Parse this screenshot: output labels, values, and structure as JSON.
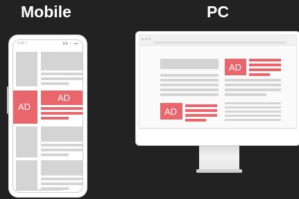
{
  "headings": {
    "mobile": "Mobile",
    "pc": "PC"
  },
  "phone": {
    "status_time": "3:33 ⇧",
    "status_icons": "▮▮ ◐ ▬",
    "ad_left": "AD",
    "ad_right": "AD"
  },
  "pc": {
    "ad_top": "AD",
    "ad_bottom": "AD"
  },
  "colors": {
    "background": "#222222",
    "ad_red": "#e9666c",
    "placeholder_gray": "#d4d4d4",
    "device_white": "#ffffff"
  }
}
